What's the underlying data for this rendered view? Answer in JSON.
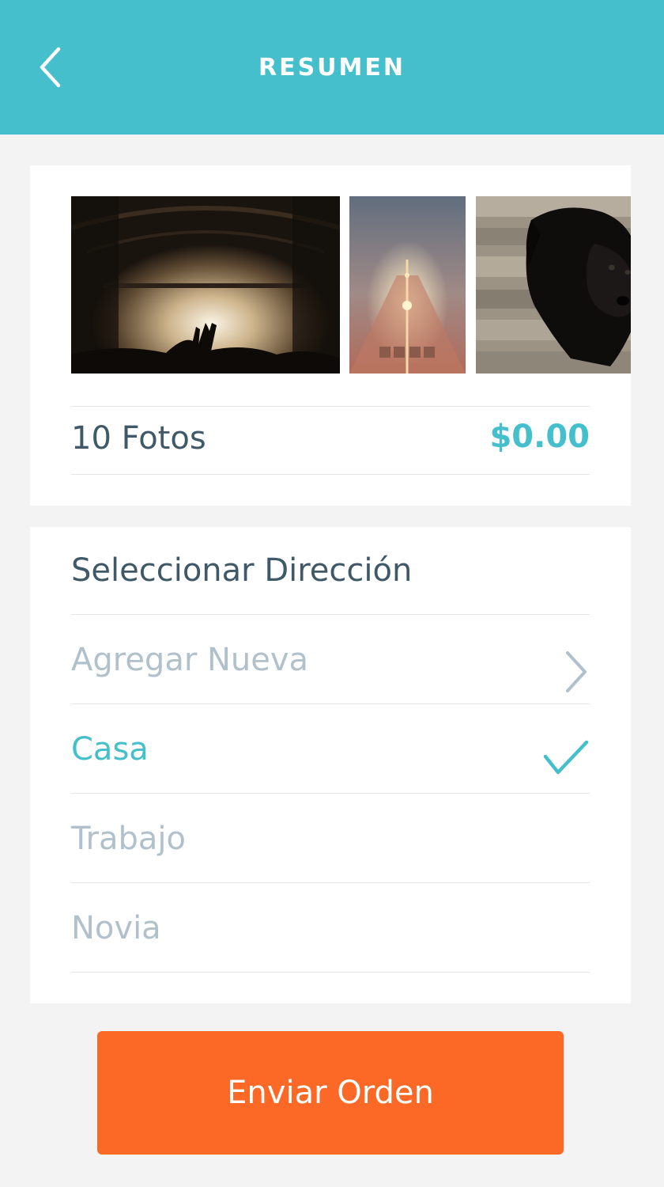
{
  "header": {
    "title": "RESUMEN",
    "back_icon": "chevron-left-icon"
  },
  "photos": [
    {
      "subject": "concert-stage"
    },
    {
      "subject": "foggy-street-lights"
    },
    {
      "subject": "black-puppy"
    }
  ],
  "summary": {
    "count_label": "10 Fotos",
    "price": "$0.00"
  },
  "address": {
    "title": "Seleccionar Dirección",
    "add_new_label": "Agregar Nueva",
    "options": [
      {
        "label": "Casa",
        "selected": true
      },
      {
        "label": "Trabajo",
        "selected": false
      },
      {
        "label": "Novia",
        "selected": false
      }
    ]
  },
  "submit": {
    "label": "Enviar Orden"
  },
  "colors": {
    "accent": "#45bfcc",
    "button": "#fc6825",
    "text_dark": "#3f5968",
    "text_muted": "#b1c1cb",
    "background": "#f3f3f3"
  }
}
